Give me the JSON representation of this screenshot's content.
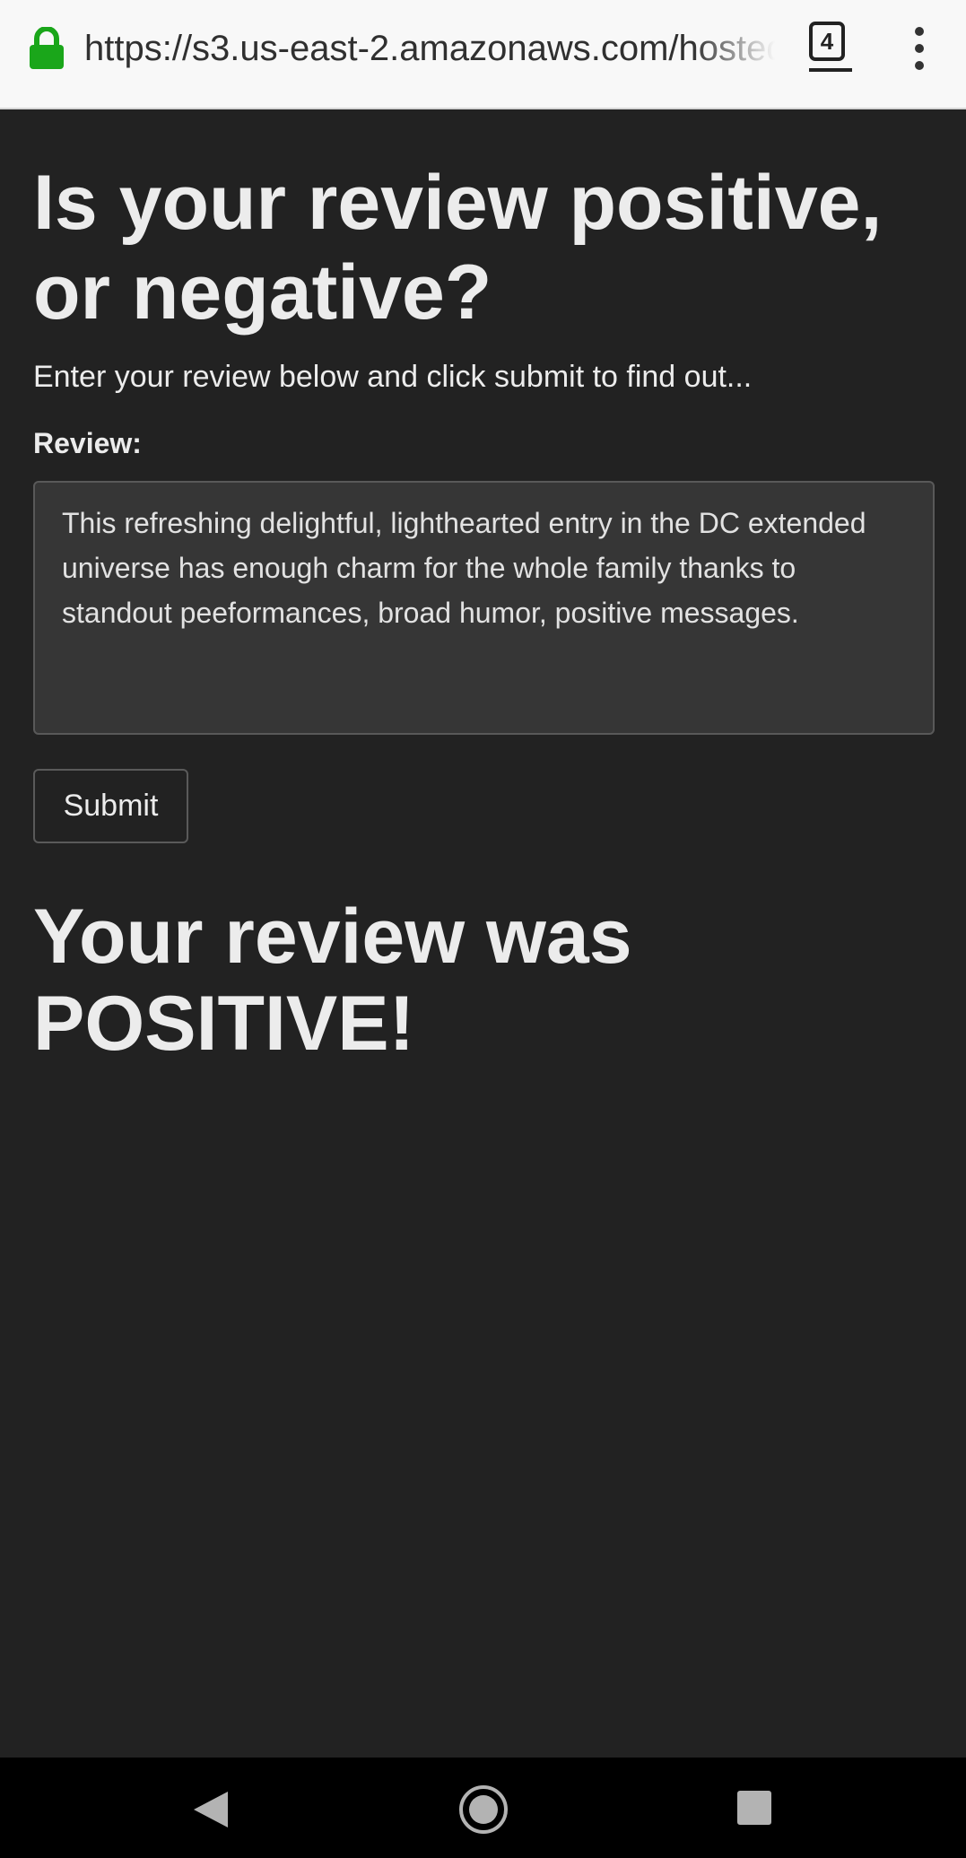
{
  "browser": {
    "url": "https://s3.us-east-2.amazonaws.com/hosted",
    "tab_count": "4",
    "lock_icon": "lock-icon",
    "lock_color": "#1aa61a"
  },
  "page": {
    "heading": "Is your review positive, or negative?",
    "subtitle": "Enter your review below and click submit to find out...",
    "review_label": "Review:",
    "review_text": "This refreshing delightful, lighthearted entry in the DC extended universe has enough charm for the whole family thanks to standout peeformances, broad humor, positive messages.",
    "submit_label": "Submit",
    "result": "Your review was POSITIVE!"
  },
  "colors": {
    "background": "#222222",
    "text": "#ececec",
    "input_background": "#363636"
  },
  "nav_icons": [
    "back-icon",
    "home-icon",
    "recents-icon"
  ]
}
